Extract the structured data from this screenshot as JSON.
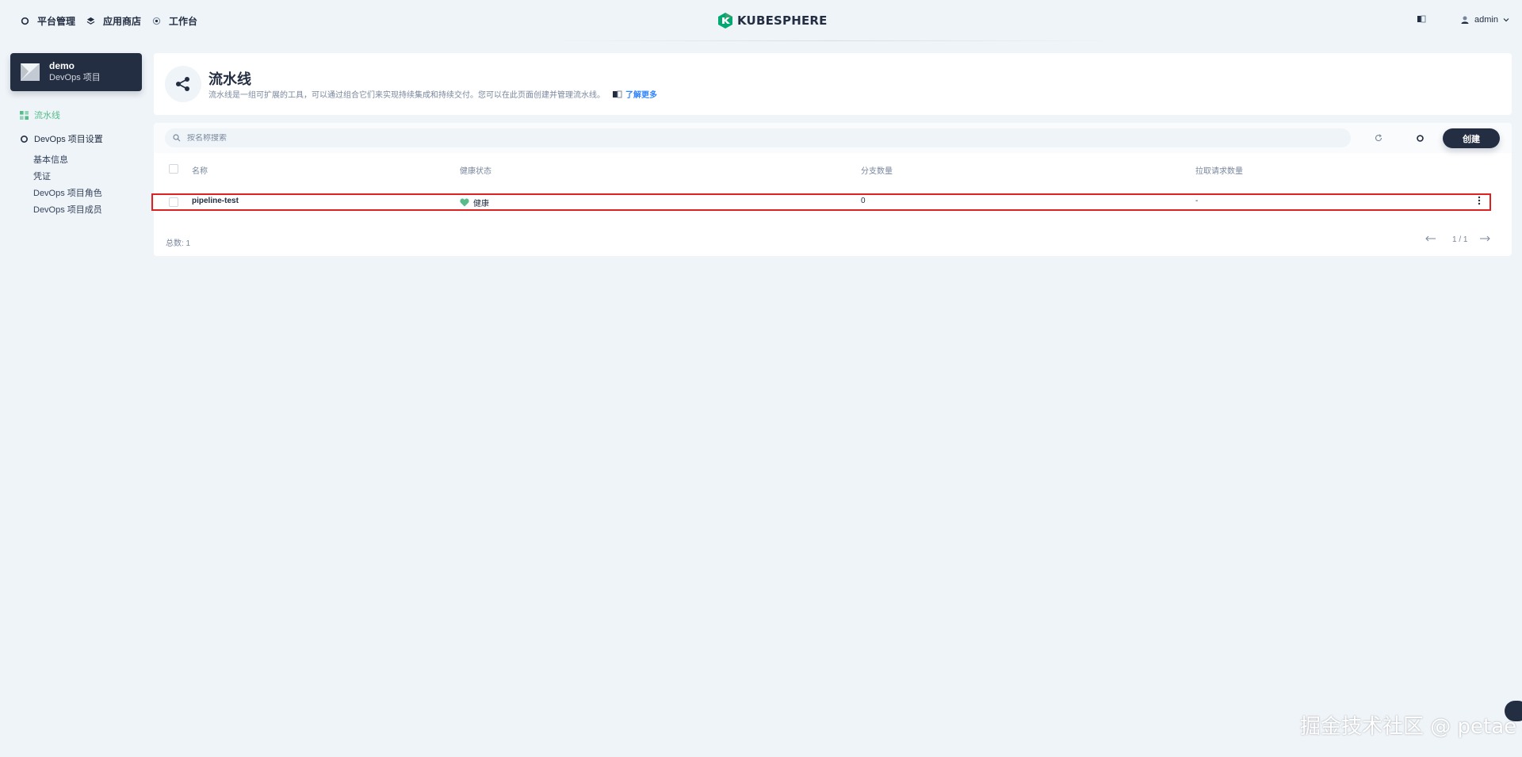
{
  "nav": {
    "items": [
      {
        "label": "平台管理",
        "icon": "gear-icon"
      },
      {
        "label": "应用商店",
        "icon": "stack-icon"
      },
      {
        "label": "工作台",
        "icon": "target-icon"
      }
    ],
    "logo_text": "KUBESPHERE",
    "user_name": "admin"
  },
  "project": {
    "name": "demo",
    "type": "DevOps 项目"
  },
  "sidebar": {
    "pipelines_label": "流水线",
    "settings_label": "DevOps 项目设置",
    "sub_items": [
      "基本信息",
      "凭证",
      "DevOps 项目角色",
      "DevOps 项目成员"
    ]
  },
  "header": {
    "title": "流水线",
    "description": "流水线是一组可扩展的工具，可以通过组合它们来实现持续集成和持续交付。您可以在此页面创建并管理流水线。",
    "learn_more": "了解更多"
  },
  "toolbar": {
    "search_placeholder": "按名称搜索",
    "create_label": "创建"
  },
  "table": {
    "columns": [
      "名称",
      "健康状态",
      "分支数量",
      "拉取请求数量"
    ],
    "rows": [
      {
        "name": "pipeline-test",
        "health": "健康",
        "branches": "0",
        "pull_requests": "-"
      }
    ]
  },
  "footer": {
    "total": "总数:  1",
    "page": "1 / 1"
  },
  "watermark": "掘金技术社区 @ petae",
  "colors": {
    "accent": "#55bc8a",
    "dark": "#242e42",
    "link": "#3385ff",
    "highlight": "#e02020"
  }
}
